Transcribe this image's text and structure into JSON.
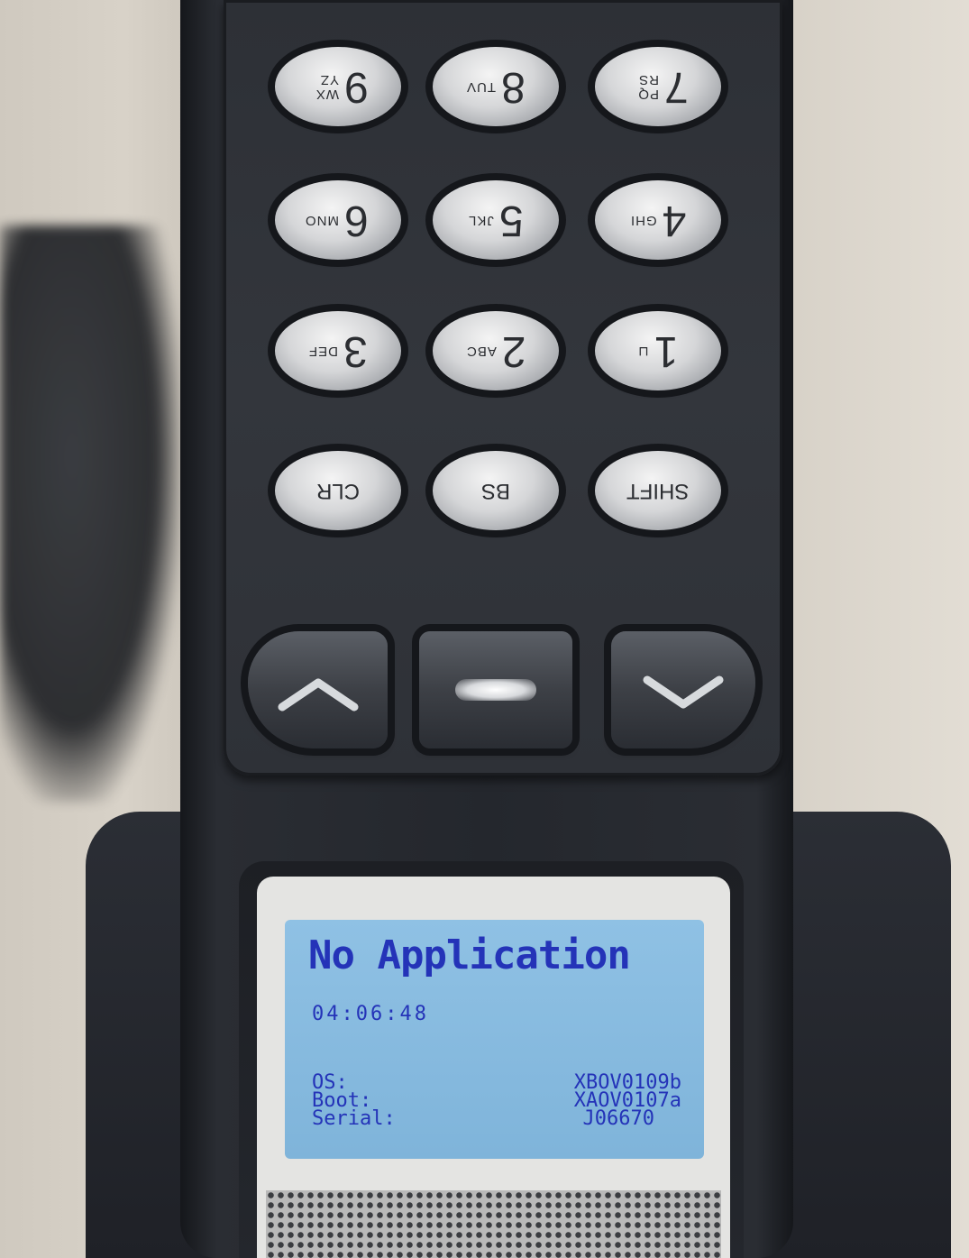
{
  "keypad": {
    "rows": [
      [
        {
          "name": "key-9",
          "digit": "9",
          "letters": "WX YZ"
        },
        {
          "name": "key-8",
          "digit": "8",
          "letters": "TUV"
        },
        {
          "name": "key-7",
          "digit": "7",
          "letters": "PQ RS"
        }
      ],
      [
        {
          "name": "key-6",
          "digit": "6",
          "letters": "MNO"
        },
        {
          "name": "key-5",
          "digit": "5",
          "letters": "JKL"
        },
        {
          "name": "key-4",
          "digit": "4",
          "letters": "GHI"
        }
      ],
      [
        {
          "name": "key-3",
          "digit": "3",
          "letters": "DEF"
        },
        {
          "name": "key-2",
          "digit": "2",
          "letters": "ABC"
        },
        {
          "name": "key-1",
          "digit": "1",
          "letters": "⊔"
        }
      ],
      [
        {
          "name": "key-clr",
          "word": "CLR"
        },
        {
          "name": "key-bs",
          "word": "BS"
        },
        {
          "name": "key-shift",
          "word": "SHIFT"
        }
      ]
    ]
  },
  "nav": {
    "up_symbol": "^",
    "down_symbol": "v"
  },
  "lcd": {
    "title": "No Application",
    "time": "04:06:48",
    "rows": [
      {
        "label": "OS:",
        "value": "XBOV0109b"
      },
      {
        "label": "Boot:",
        "value": "XAOV0107a"
      },
      {
        "label": "Serial:",
        "value": "J06670"
      }
    ],
    "text_color": "#2433b8",
    "background_color": "#8fc1e4"
  }
}
